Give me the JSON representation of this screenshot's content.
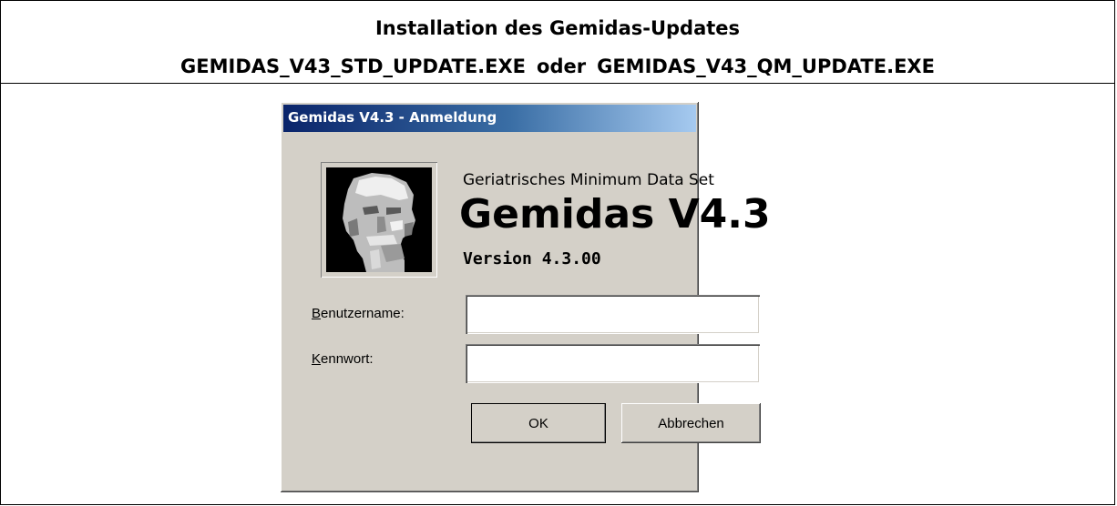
{
  "document": {
    "title_line1": "Installation des Gemidas-Updates",
    "title_file1": "GEMIDAS_V43_STD_UPDATE.EXE",
    "title_or": "oder",
    "title_file2": "GEMIDAS_V43_QM_UPDATE.EXE"
  },
  "dialog": {
    "window_title": "Gemidas V4.3 - Anmeldung",
    "subtitle": "Geriatrisches Minimum Data Set",
    "app_name": "Gemidas V4.3",
    "version": "Version 4.3.00",
    "username_label_accel": "B",
    "username_label_rest": "enutzername:",
    "username_value": "",
    "password_label_accel": "K",
    "password_label_rest": "ennwort:",
    "password_value": "",
    "ok_label": "OK",
    "cancel_label": "Abbrechen"
  },
  "colors": {
    "titlebar_start": "#0a246a",
    "titlebar_end": "#a6caf0",
    "dialog_face": "#d4d0c8"
  },
  "icons": {
    "logo": "elderly-face-logo"
  }
}
